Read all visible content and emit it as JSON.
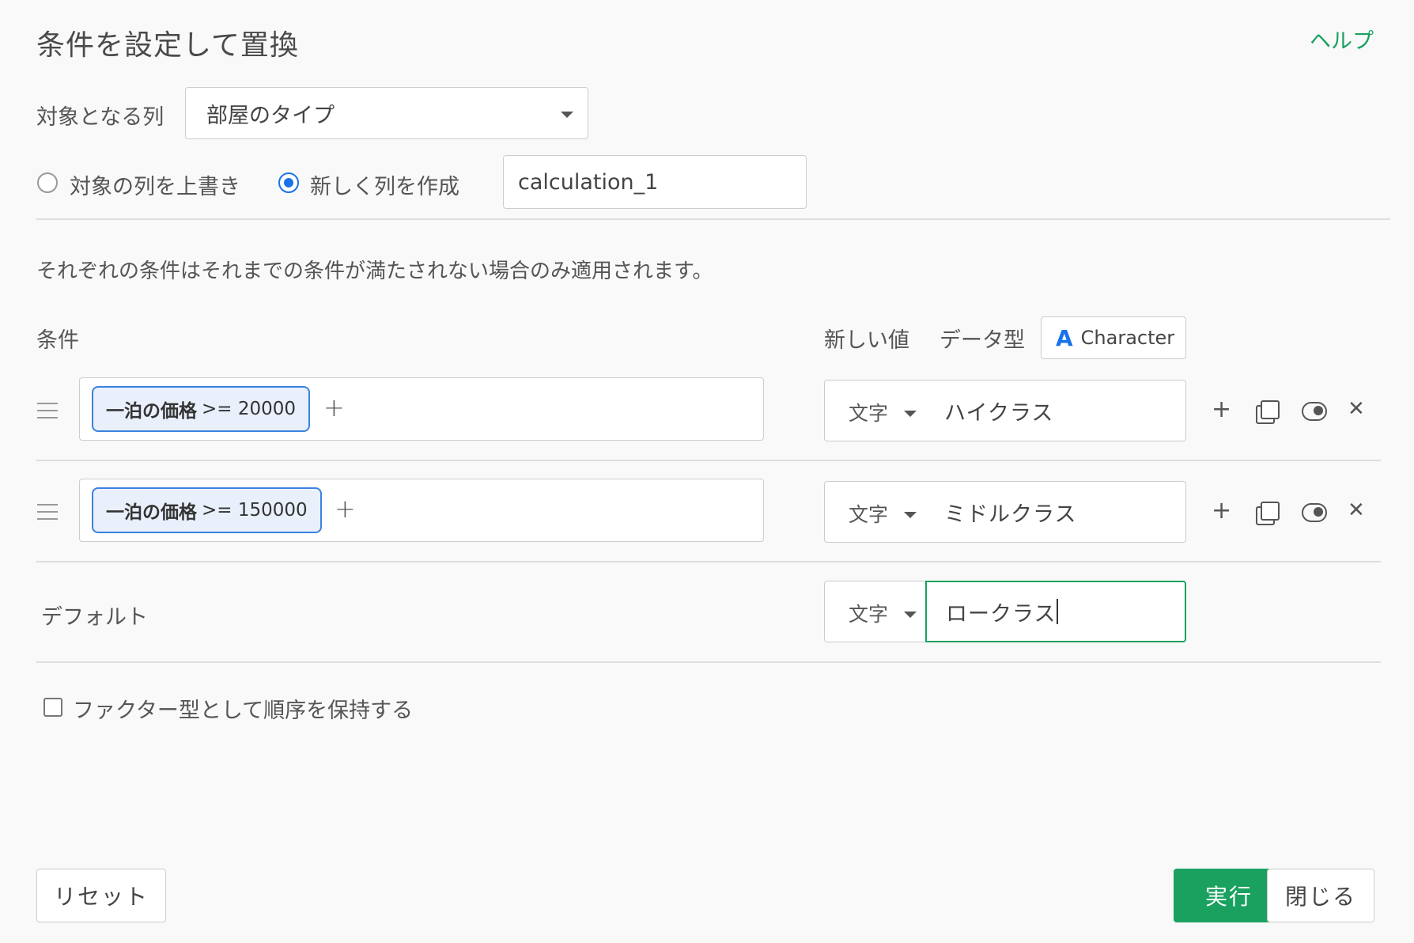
{
  "dialog": {
    "title": "条件を設定して置換",
    "help_label": "ヘルプ"
  },
  "target": {
    "label": "対象となる列",
    "selected_column": "部屋のタイプ"
  },
  "output_mode": {
    "overwrite_label": "対象の列を上書き",
    "new_column_label": "新しく列を作成",
    "selected": "new_column",
    "new_column_name": "calculation_1"
  },
  "description": "それぞれの条件はそれまでの条件が満たされない場合のみ適用されます。",
  "header": {
    "conditions_label": "条件",
    "new_value_label": "新しい値",
    "data_type_label": "データ型",
    "data_type_icon": "A",
    "data_type_value": "Character"
  },
  "rules": [
    {
      "chip_field": "一泊の価格",
      "chip_op": ">= 20000",
      "add_symbol": "+",
      "value_type": "文字",
      "value": "ハイクラス"
    },
    {
      "chip_field": "一泊の価格",
      "chip_op": ">= 150000",
      "add_symbol": "+",
      "value_type": "文字",
      "value": "ミドルクラス"
    }
  ],
  "row_actions": {
    "add_symbol": "+",
    "remove_symbol": "✕"
  },
  "default_rule": {
    "label": "デフォルト",
    "value_type": "文字",
    "value": "ロークラス"
  },
  "factor_option": {
    "label": "ファクター型として順序を保持する",
    "checked": false
  },
  "footer": {
    "reset_label": "リセット",
    "run_label": "実行",
    "close_label": "閉じる"
  },
  "colors": {
    "accent": "#1aa160",
    "chip_border": "#3b82e0",
    "radio_selected": "#1a73e8"
  }
}
